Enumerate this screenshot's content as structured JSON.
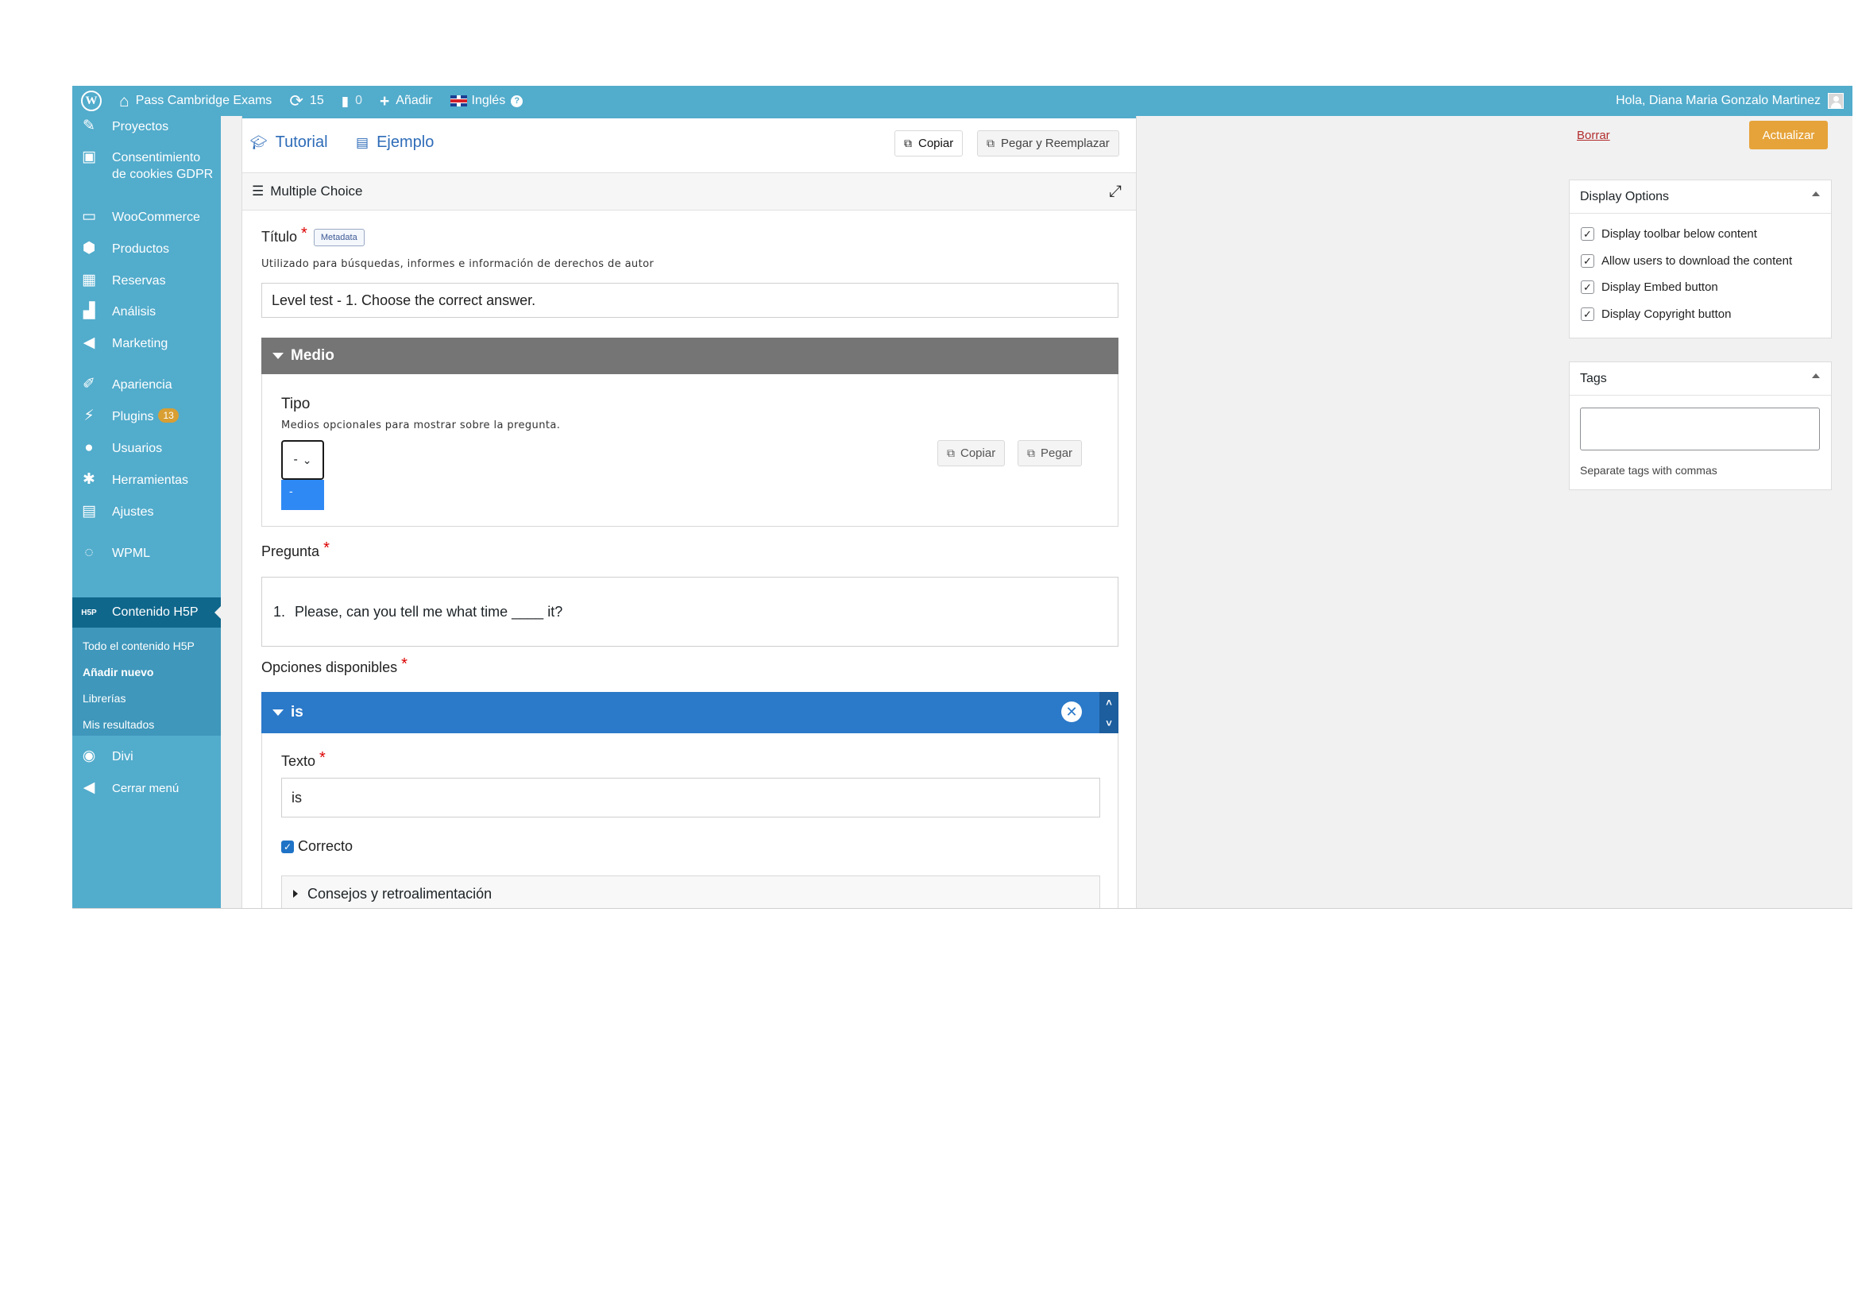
{
  "admin_bar": {
    "site_name": "Pass Cambridge Exams",
    "updates_count": "15",
    "comments_count": "0",
    "add_label": "Añadir",
    "language_label": "Inglés",
    "greeting": "Hola, Diana Maria Gonzalo Martinez",
    "icons": [
      "wordpress-logo-icon",
      "home-icon",
      "refresh-icon",
      "comment-icon",
      "plus-icon",
      "uk-flag-icon",
      "help-icon",
      "avatar"
    ]
  },
  "sidebar": {
    "items": [
      {
        "label": "Proyectos",
        "icon": "pin-icon"
      },
      {
        "label": "Consentimiento de cookies GDPR",
        "line1": "Consentimiento",
        "line2": "de cookies GDPR",
        "icon": "lock-icon"
      },
      {
        "label": "WooCommerce",
        "icon": "woocommerce-icon"
      },
      {
        "label": "Productos",
        "icon": "box-icon"
      },
      {
        "label": "Reservas",
        "icon": "calendar-icon"
      },
      {
        "label": "Análisis",
        "icon": "bar-chart-icon"
      },
      {
        "label": "Marketing",
        "icon": "megaphone-icon"
      },
      {
        "label": "Apariencia",
        "icon": "brush-icon"
      },
      {
        "label": "Plugins",
        "badge": "13",
        "icon": "plug-icon"
      },
      {
        "label": "Usuarios",
        "icon": "user-icon"
      },
      {
        "label": "Herramientas",
        "icon": "wrench-icon"
      },
      {
        "label": "Ajustes",
        "icon": "settings-icon"
      },
      {
        "label": "WPML",
        "icon": "wpml-icon"
      }
    ],
    "current": {
      "label": "Contenido H5P",
      "icon": "h5p-icon"
    },
    "submenu": [
      "Todo el contenido H5P",
      "Añadir nuevo",
      "Librerías",
      "Mis resultados"
    ],
    "after": [
      {
        "label": "Divi",
        "icon": "divi-icon"
      },
      {
        "label": "Cerrar menú",
        "icon": "collapse-icon"
      }
    ]
  },
  "editor": {
    "tutorial_label": "Tutorial",
    "example_label": "Ejemplo",
    "copy_label": "Copiar",
    "paste_replace_label": "Pegar y Reemplazar",
    "content_type": "Multiple Choice",
    "title_label": "Título",
    "metadata_label": "Metadata",
    "title_desc": "Utilizado para búsquedas, informes e información de derechos de autor",
    "title_value": "Level test - 1. Choose the correct answer.",
    "media": {
      "header": "Medio",
      "type_label": "Tipo",
      "type_desc": "Medios opcionales para mostrar sobre la pregunta.",
      "select_value": "-",
      "select_option": "-",
      "copy_label": "Copiar",
      "paste_label": "Pegar"
    },
    "question_label": "Pregunta",
    "question_number": "1.",
    "question_text": "Please, can you tell me what time ____ it?",
    "options_label": "Opciones disponibles",
    "option": {
      "header": "is",
      "text_label": "Texto",
      "text_value": "is",
      "correct_label": "Correcto",
      "correct_checked": true,
      "tips_label": "Consejos y retroalimentación"
    }
  },
  "publish": {
    "delete_label": "Borrar",
    "update_label": "Actualizar"
  },
  "display_options": {
    "title": "Display Options",
    "items": [
      {
        "label": "Display toolbar below content",
        "checked": true
      },
      {
        "label": "Allow users to download the content",
        "checked": true
      },
      {
        "label": "Display Embed button",
        "checked": true
      },
      {
        "label": "Display Copyright button",
        "checked": true
      }
    ]
  },
  "tags": {
    "title": "Tags",
    "value": "",
    "note": "Separate tags with commas"
  },
  "colors": {
    "admin_blue": "#52accc",
    "current_menu": "#0f678c",
    "media_header": "#757575",
    "option_header": "#2b79c9",
    "update_button": "#e6a33a"
  }
}
